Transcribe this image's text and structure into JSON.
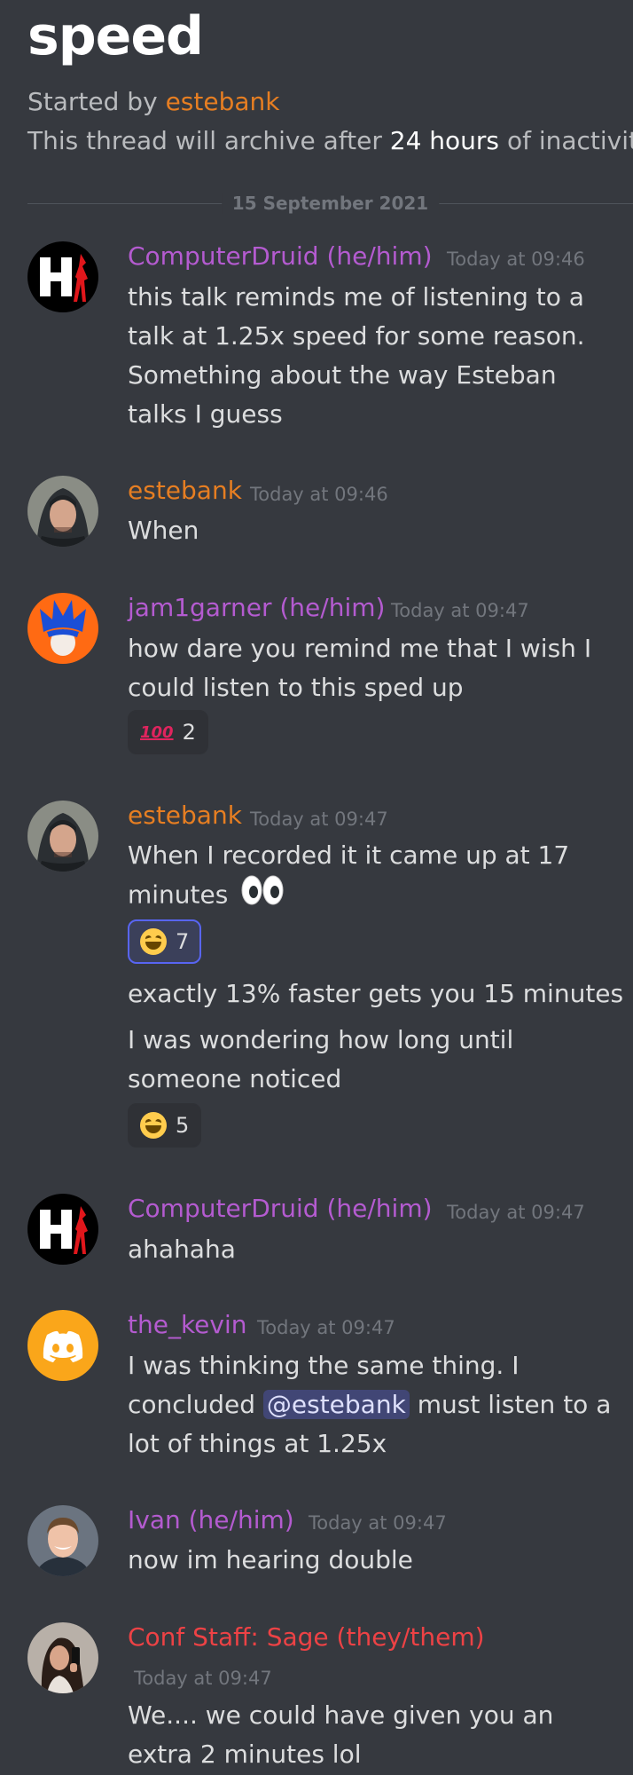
{
  "thread": {
    "title": "speed",
    "started_prefix": "Started by",
    "started_author": "estebank",
    "archive_prefix": "This thread will archive after",
    "archive_highlight": "24 hours",
    "archive_suffix": "of inactivity.",
    "date_divider": "15 September 2021"
  },
  "colors": {
    "background": "#36393f",
    "purple_name": "#b45bd0",
    "orange_name": "#e67e22",
    "red_name": "#ed4245",
    "timestamp": "#72767d",
    "reaction_active_border": "#5865f2"
  },
  "messages": [
    {
      "author": "ComputerDruid (he/him)",
      "timestamp": "Today at 09:46",
      "avatar": "hi-logo-avatar",
      "lines": [
        "this talk reminds me of listening to a",
        "talk at 1.25x speed for some reason.",
        "Something about the way Esteban",
        "talks I guess"
      ]
    },
    {
      "author": "estebank",
      "timestamp": "Today at 09:46",
      "avatar": "hooded-person-avatar",
      "lines": [
        "When"
      ]
    },
    {
      "author": "jam1garner (he/him)",
      "timestamp": "Today at 09:47",
      "avatar": "blue-hair-character-avatar",
      "lines": [
        "how dare you remind me that I wish I",
        "could listen to this sped up"
      ],
      "reactions": [
        {
          "emoji": "hundred-points-emoji",
          "count": "2"
        }
      ]
    },
    {
      "author": "estebank",
      "timestamp": "Today at 09:47",
      "avatar": "hooded-person-avatar",
      "lines": [
        "When I recorded it it came up at 17",
        "minutes"
      ],
      "inline_emoji": "eyes-emoji",
      "reactions": [
        {
          "emoji": "grinning-squinting-face-emoji",
          "count": "7",
          "active": true
        }
      ],
      "followups": [
        {
          "lines": [
            "exactly 13% faster gets you 15 minutes"
          ]
        },
        {
          "lines": [
            "I was wondering how long until",
            "someone noticed"
          ],
          "reactions": [
            {
              "emoji": "grinning-squinting-face-emoji",
              "count": "5"
            }
          ]
        }
      ]
    },
    {
      "author": "ComputerDruid (he/him)",
      "timestamp": "Today at 09:47",
      "avatar": "hi-logo-avatar",
      "lines": [
        "ahahaha"
      ]
    },
    {
      "author": "the_kevin",
      "timestamp": "Today at 09:47",
      "avatar": "discord-logo-avatar",
      "line1": "I was thinking the same thing.  I",
      "line2_prefix": "concluded",
      "mention": "@estebank",
      "line2_suffix": "must listen to a",
      "line3": "lot of things at 1.25x"
    },
    {
      "author": "Ivan (he/him)",
      "timestamp": "Today at 09:47",
      "avatar": "smiling-man-avatar",
      "lines": [
        "now im hearing double"
      ]
    },
    {
      "author": "Conf Staff: Sage (they/them)",
      "timestamp": "Today at 09:47",
      "avatar": "woman-selfie-avatar",
      "lines": [
        "We.... we could have given you an",
        "extra 2 minutes lol"
      ]
    }
  ]
}
